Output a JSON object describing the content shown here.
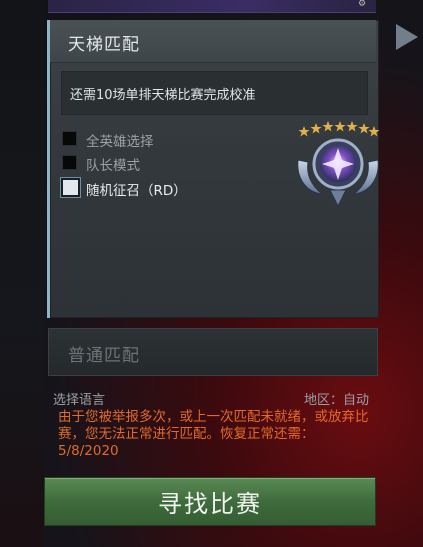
{
  "ranked": {
    "title": "天梯匹配",
    "notice": "还需10场单排天梯比赛完成校准",
    "options": [
      {
        "label": "全英雄选择",
        "checked": false
      },
      {
        "label": "队长模式",
        "checked": false
      },
      {
        "label": "随机征召（RD）",
        "checked": true
      }
    ],
    "medal_icon": "rank-medal-icon"
  },
  "normal": {
    "title": "普通匹配"
  },
  "meta": {
    "language_label": "选择语言",
    "region_label": "地区：自动"
  },
  "warning": "由于您被举报多次，或上一次匹配未就绪，或放弃比赛，您无法正常进行匹配。恢复正常还需：5/8/2020",
  "find_button": "寻找比赛",
  "colors": {
    "accent_green": "#4a7a46",
    "warning_orange": "#e36a2a",
    "panel_accent": "#8fb4c6"
  }
}
